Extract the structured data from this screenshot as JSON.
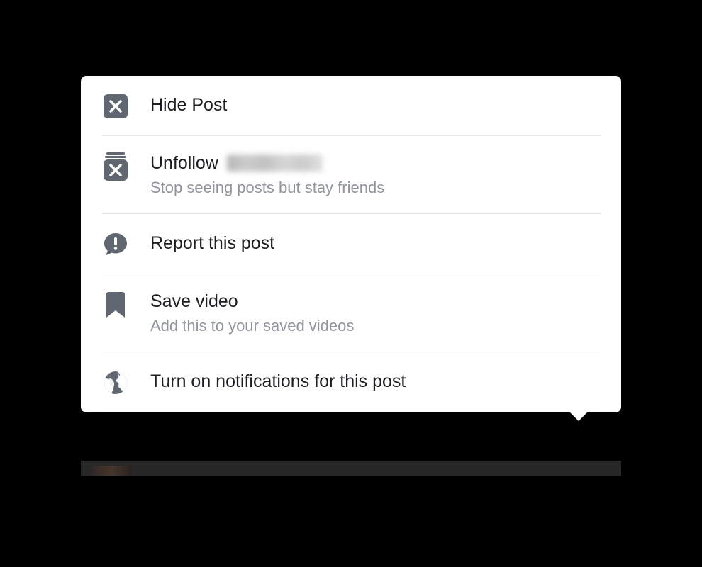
{
  "menu": {
    "items": [
      {
        "icon": "close-box-icon",
        "title": "Hide Post",
        "subtitle": null
      },
      {
        "icon": "unfollow-icon",
        "title": "Unfollow",
        "subtitle": "Stop seeing posts but stay friends",
        "obscured_name": true
      },
      {
        "icon": "report-icon",
        "title": "Report this post",
        "subtitle": null
      },
      {
        "icon": "bookmark-icon",
        "title": "Save video",
        "subtitle": "Add this to your saved videos"
      },
      {
        "icon": "globe-icon",
        "title": "Turn on notifications for this post",
        "subtitle": null
      }
    ]
  },
  "colors": {
    "icon": "#616770",
    "text": "#1c1e21",
    "subtitle": "#90949c",
    "divider": "#e5e5e5",
    "bg": "#ffffff"
  }
}
